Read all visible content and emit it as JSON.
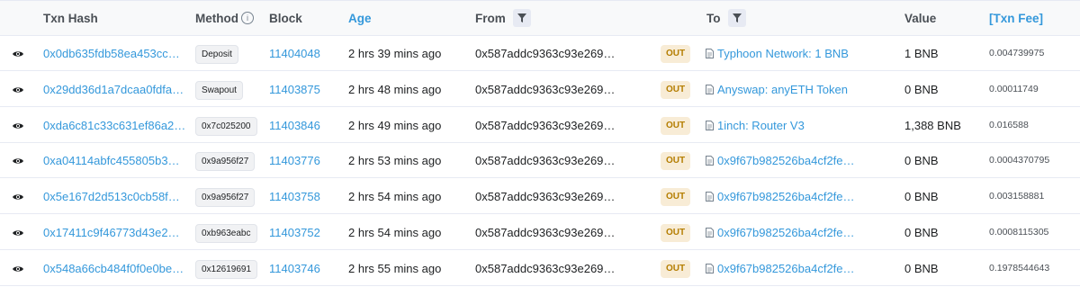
{
  "headers": {
    "txn_hash": "Txn Hash",
    "method": "Method",
    "block": "Block",
    "age": "Age",
    "from": "From",
    "to": "To",
    "value": "Value",
    "txn_fee": "[Txn Fee]"
  },
  "info_icon_glyph": "i",
  "colors": {
    "link": "#3498db",
    "out_badge_bg": "#f8ecd6",
    "out_badge_text": "#b47d00",
    "header_bg": "#f8f9fa"
  },
  "rows": [
    {
      "hash": "0x0db635fdb58ea453cc…",
      "method": "Deposit",
      "block": "11404048",
      "age": "2 hrs 39 mins ago",
      "from": "0x587addc9363c93e269…",
      "direction": "OUT",
      "to": "Typhoon Network: 1 BNB",
      "value": "1 BNB",
      "fee": "0.004739975"
    },
    {
      "hash": "0x29dd36d1a7dcaa0fdfa…",
      "method": "Swapout",
      "block": "11403875",
      "age": "2 hrs 48 mins ago",
      "from": "0x587addc9363c93e269…",
      "direction": "OUT",
      "to": "Anyswap: anyETH Token",
      "value": "0 BNB",
      "fee": "0.00011749"
    },
    {
      "hash": "0xda6c81c33c631ef86a2…",
      "method": "0x7c025200",
      "block": "11403846",
      "age": "2 hrs 49 mins ago",
      "from": "0x587addc9363c93e269…",
      "direction": "OUT",
      "to": "1inch: Router V3",
      "value": "1,388 BNB",
      "fee": "0.016588"
    },
    {
      "hash": "0xa04114abfc455805b3…",
      "method": "0x9a956f27",
      "block": "11403776",
      "age": "2 hrs 53 mins ago",
      "from": "0x587addc9363c93e269…",
      "direction": "OUT",
      "to": "0x9f67b982526ba4cf2fe…",
      "value": "0 BNB",
      "fee": "0.0004370795"
    },
    {
      "hash": "0x5e167d2d513c0cb58f…",
      "method": "0x9a956f27",
      "block": "11403758",
      "age": "2 hrs 54 mins ago",
      "from": "0x587addc9363c93e269…",
      "direction": "OUT",
      "to": "0x9f67b982526ba4cf2fe…",
      "value": "0 BNB",
      "fee": "0.003158881"
    },
    {
      "hash": "0x17411c9f46773d43e2…",
      "method": "0xb963eabc",
      "block": "11403752",
      "age": "2 hrs 54 mins ago",
      "from": "0x587addc9363c93e269…",
      "direction": "OUT",
      "to": "0x9f67b982526ba4cf2fe…",
      "value": "0 BNB",
      "fee": "0.0008115305"
    },
    {
      "hash": "0x548a66cb484f0f0e0be…",
      "method": "0x12619691",
      "block": "11403746",
      "age": "2 hrs 55 mins ago",
      "from": "0x587addc9363c93e269…",
      "direction": "OUT",
      "to": "0x9f67b982526ba4cf2fe…",
      "value": "0 BNB",
      "fee": "0.1978544643"
    }
  ]
}
